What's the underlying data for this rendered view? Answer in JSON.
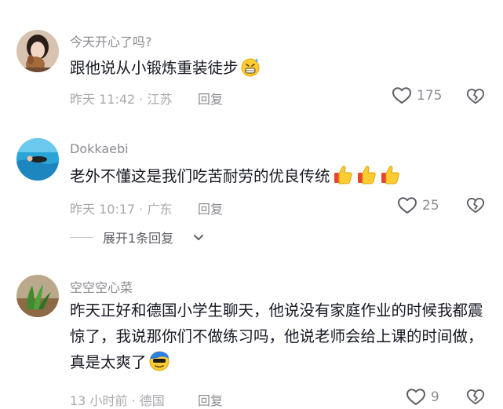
{
  "comments": [
    {
      "username": "今天开心了吗?",
      "text": "跟他说从小锻炼重装徒步",
      "meta": "昨天 11:42 · 江苏",
      "reply_label": "回复",
      "likes": "175"
    },
    {
      "username": "Dokkaebi",
      "text": "老外不懂这是我们吃苦耐劳的优良传统",
      "meta": "昨天 10:17 · 广东",
      "reply_label": "回复",
      "likes": "25"
    },
    {
      "username": "空空空心菜",
      "text": "昨天正好和德国小学生聊天，他说没有家庭作业的时候我都震惊了，我说那你们不做练习吗，他说老师会给上课的时间做，真是太爽了",
      "meta": "13 小时前 · 德国",
      "reply_label": "回复",
      "likes": "9"
    }
  ],
  "expand_replies": {
    "label": "展开1条回复"
  },
  "icons": {
    "like": "heart-outline-icon",
    "dislike": "broken-heart-icon",
    "chevron": "chevron-down-icon"
  },
  "colors": {
    "text_primary": "#161823",
    "text_secondary": "#8a8b91",
    "emoji_yellow": "#ffcc33"
  }
}
